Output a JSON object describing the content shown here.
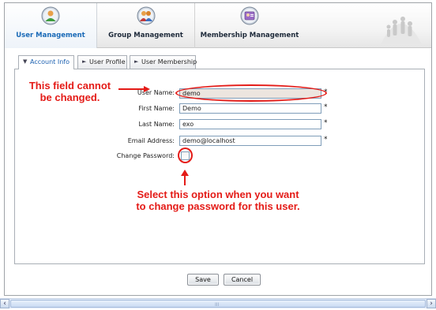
{
  "nav": {
    "items": [
      {
        "label": "User Management"
      },
      {
        "label": "Group Management"
      },
      {
        "label": "Membership Management"
      }
    ]
  },
  "tabs": [
    {
      "label": "Account Info"
    },
    {
      "label": "User Profile"
    },
    {
      "label": "User Membership"
    }
  ],
  "form": {
    "username": {
      "label": "User Name:",
      "value": "demo",
      "required": "*"
    },
    "firstname": {
      "label": "First Name:",
      "value": "Demo",
      "required": "*"
    },
    "lastname": {
      "label": "Last Name:",
      "value": "exo",
      "required": "*"
    },
    "email": {
      "label": "Email Address:",
      "value": "demo@localhost",
      "required": "*"
    },
    "change_password": {
      "label": "Change Password:"
    }
  },
  "annotations": {
    "username_note_line1": "This field cannot",
    "username_note_line2": "be changed.",
    "password_note_line1": "Select this option when you want",
    "password_note_line2": "to change password for this user."
  },
  "buttons": {
    "save": "Save",
    "cancel": "Cancel"
  },
  "scrollbar": {
    "grip": "III"
  },
  "colors": {
    "annotation": "#e41b17",
    "accent": "#1a6ab7"
  }
}
